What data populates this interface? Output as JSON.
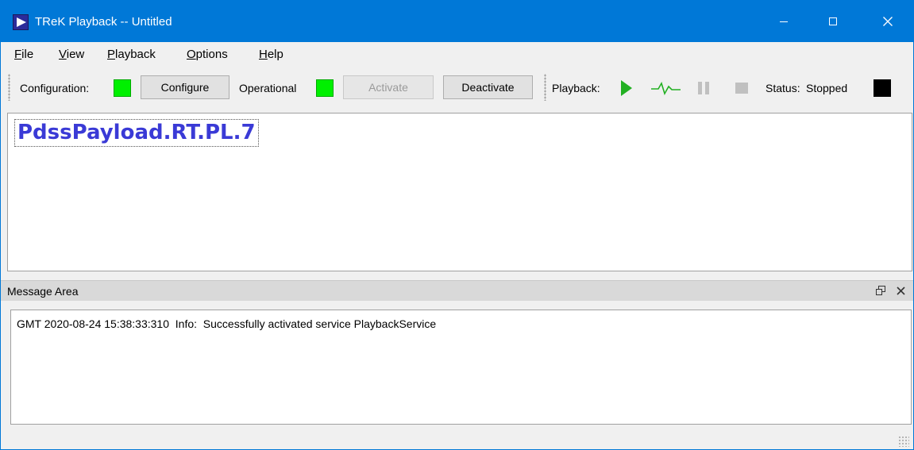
{
  "window": {
    "title": "TReK Playback -- Untitled"
  },
  "menu": {
    "file": {
      "mnemonic": "F",
      "rest": "ile"
    },
    "view": {
      "mnemonic": "V",
      "rest": "iew"
    },
    "playback": {
      "mnemonic": "P",
      "rest": "layback"
    },
    "options": {
      "mnemonic": "O",
      "rest": "ptions"
    },
    "help": {
      "mnemonic": "H",
      "rest": "elp"
    }
  },
  "toolbar": {
    "configuration_label": "Configuration:",
    "configuration_status_color": "#00f000",
    "configure_label": "Configure",
    "operational_label": "Operational",
    "operational_status_color": "#00f000",
    "activate_label": "Activate",
    "activate_enabled": false,
    "deactivate_label": "Deactivate",
    "playback_label": "Playback:",
    "status_label": "Status:",
    "status_value": "Stopped",
    "status_color": "#000000",
    "icons": [
      "play-icon",
      "pulse-icon",
      "pause-icon",
      "stop-icon"
    ]
  },
  "main": {
    "payload_name": "PdssPayload.RT.PL.7",
    "payload_color": "#3a3ad6"
  },
  "message_area": {
    "title": "Message Area",
    "messages": [
      "GMT 2020-08-24 15:38:33:310  Info:  Successfully activated service PlaybackService"
    ]
  },
  "colors": {
    "titlebar": "#0078d7",
    "led_on": "#00f000"
  }
}
